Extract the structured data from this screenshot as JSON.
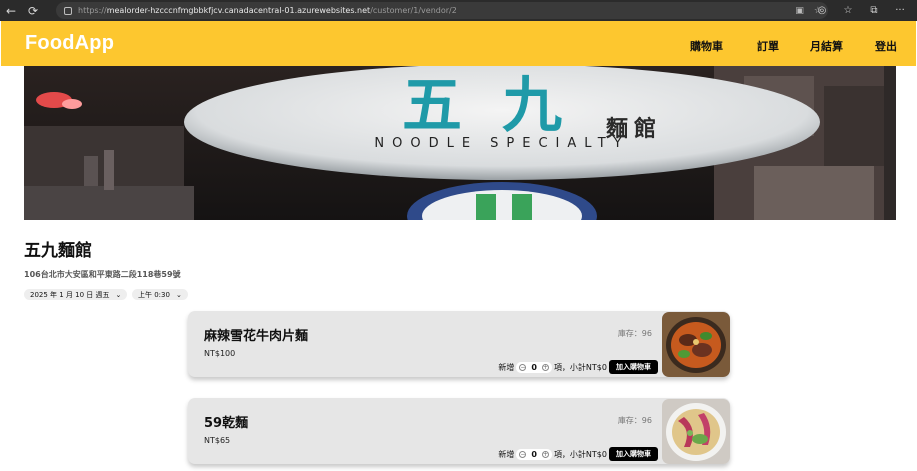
{
  "browser": {
    "url_prefix": "https://",
    "url_host": "mealorder-hzcccnfmgbbkfjcv.canadacentral-01.azurewebsites.net",
    "url_path": "/customer/1/vendor/2"
  },
  "nav": {
    "brand": "FoodApp",
    "items": [
      "購物車",
      "訂單",
      "月結算",
      "登出"
    ]
  },
  "banner": {
    "sign_text": "NOODLE SPECIALTY"
  },
  "vendor": {
    "name": "五九麵館",
    "address": "106台北市大安區和平東路二段118巷59號",
    "date": "2025 年 1 月 10 日 週五",
    "time": "上午 0:30"
  },
  "menu": [
    {
      "name": "麻辣雪花牛肉片麵",
      "price": "NT$100",
      "stock": "庫存：96",
      "add_label": "新增",
      "qty": "0",
      "subtotal": "項，小計NT$0",
      "button": "加入購物車"
    },
    {
      "name": "59乾麵",
      "price": "NT$65",
      "stock": "庫存：96",
      "add_label": "新增",
      "qty": "0",
      "subtotal": "項，小計NT$0",
      "button": "加入購物車"
    }
  ],
  "colors": {
    "navbar": "#fdc72f",
    "card": "#e6e6e6",
    "button": "#000000"
  }
}
